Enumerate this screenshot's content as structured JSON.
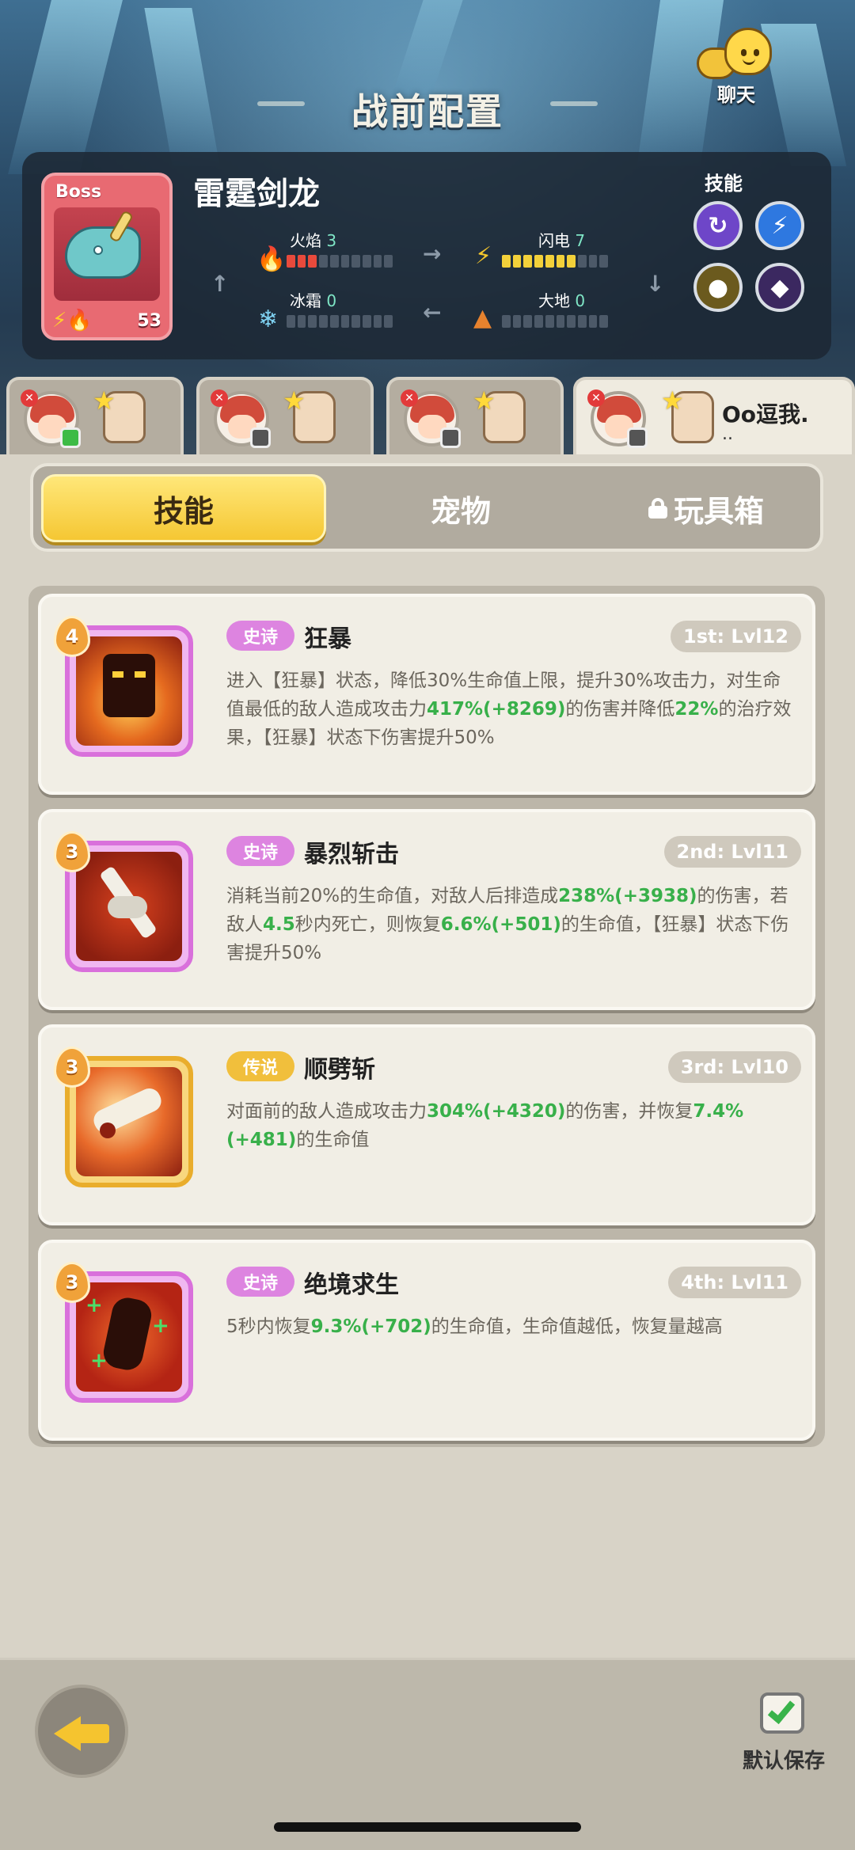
{
  "header": {
    "title": "战前配置",
    "chat_label": "聊天"
  },
  "boss": {
    "tag": "Boss",
    "name": "雷霆剑龙",
    "level": "53",
    "elements": {
      "fire": {
        "label": "火焰",
        "value": "3",
        "filled": 3
      },
      "lightning": {
        "label": "闪电",
        "value": "7",
        "filled": 7
      },
      "frost": {
        "label": "冰霜",
        "value": "0",
        "filled": 0
      },
      "earth": {
        "label": "大地",
        "value": "0",
        "filled": 0
      }
    },
    "skills_label": "技能"
  },
  "team": {
    "active_name": "Oo逗我.",
    "active_sub": ".."
  },
  "categories": {
    "skills": "技能",
    "pets": "宠物",
    "toybox": "玩具箱"
  },
  "skills": [
    {
      "level": "4",
      "rarity": "史诗",
      "name": "狂暴",
      "order": "1st: Lvl12",
      "desc_parts": [
        "进入【狂暴】状态，降低30%生命值上限，提升30%攻击力，对生命值最低的敌人造成攻击力",
        "417%(+8269)",
        "的伤害并降低",
        "22%",
        "的治疗效果，【狂暴】状态下伤害提升50%"
      ]
    },
    {
      "level": "3",
      "rarity": "史诗",
      "name": "暴烈斩击",
      "order": "2nd: Lvl11",
      "desc_parts": [
        "消耗当前20%的生命值，对敌人后排造成",
        "238%(+3938)",
        "的伤害，若敌人",
        "4.5",
        "秒内死亡，则恢复",
        "6.6%(+501)",
        "的生命值，【狂暴】状态下伤害提升50%"
      ]
    },
    {
      "level": "3",
      "rarity": "传说",
      "name": "顺劈斩",
      "order": "3rd: Lvl10",
      "desc_parts": [
        "对面前的敌人造成攻击力",
        "304%(+4320)",
        "的伤害，并恢复",
        "7.4%(+481)",
        "的生命值"
      ]
    },
    {
      "level": "3",
      "rarity": "史诗",
      "name": "绝境求生",
      "order": "4th: Lvl11",
      "desc_parts": [
        "5秒内恢复",
        "9.3%(+702)",
        "的生命值，生命值越低，恢复量越高"
      ]
    }
  ],
  "footer": {
    "save_label": "默认保存"
  },
  "colors": {
    "epic": "#dd84e0",
    "legendary": "#f1bf3c",
    "highlight": "#38b04a",
    "active_tab": "#f5c733"
  }
}
